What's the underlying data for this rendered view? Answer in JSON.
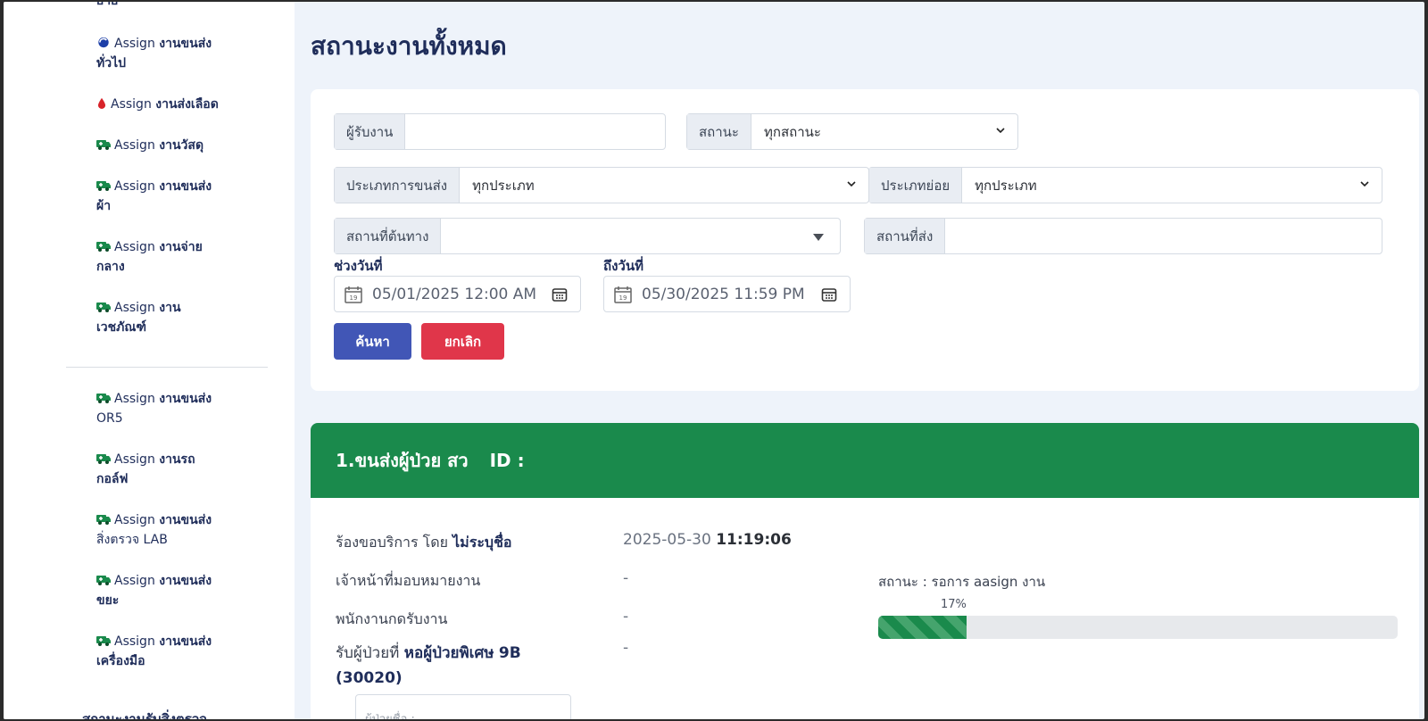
{
  "sidebar": {
    "top_cut_text": "ย้าย",
    "items": [
      {
        "en": "Assign",
        "th": "งานขนส่งทั่วไป",
        "th_a": "งานขนส่ง",
        "th_b": "ทั่วไป",
        "icon": "globe-icon"
      },
      {
        "en": "Assign",
        "th_a": "งานส่งเลือด",
        "th_b": "",
        "icon": "blood-drop-icon"
      },
      {
        "en": "Assign",
        "th_a": "งานวัสดุ",
        "th_b": "",
        "icon": "ambulance-icon"
      },
      {
        "en": "Assign",
        "th_a": "งานขนส่ง",
        "th_b": "ผ้า",
        "icon": "ambulance-icon"
      },
      {
        "en": "Assign",
        "th_a": "งานจ่าย",
        "th_b": "กลาง",
        "icon": "ambulance-icon"
      },
      {
        "en": "Assign",
        "th_a": "งาน",
        "th_b": "เวชภัณฑ์",
        "icon": "ambulance-icon"
      },
      {
        "en": "Assign",
        "th_a": "งานขนส่ง",
        "th_b": "OR5",
        "icon": "ambulance-icon"
      },
      {
        "en": "Assign",
        "th_a": "งานรถ",
        "th_b": "กอล์ฟ",
        "icon": "ambulance-icon"
      },
      {
        "en": "Assign",
        "th_a": "งานขนส่ง",
        "th_b": "สิ่งตรวจ LAB",
        "icon": "ambulance-icon"
      },
      {
        "en": "Assign",
        "th_a": "งานขนส่ง",
        "th_b": "ขยะ",
        "icon": "ambulance-icon"
      },
      {
        "en": "Assign",
        "th_a": "งานขนส่ง",
        "th_b": "เครื่องมือ",
        "icon": "ambulance-icon"
      }
    ],
    "bottom_cut_text": "สถานะงานรับสิ่งตรวจ"
  },
  "page_title": "สถานะงานทั้งหมด",
  "filters": {
    "assignee_label": "ผู้รับงาน",
    "assignee_value": "",
    "status_label": "สถานะ",
    "status_value": "ทุกสถานะ",
    "transport_type_label": "ประเภทการขนส่ง",
    "transport_type_value": "ทุกประเภท",
    "subtype_label": "ประเภทย่อย",
    "subtype_value": "ทุกประเภท",
    "origin_label": "สถานที่ต้นทาง",
    "origin_value": "",
    "destination_label": "สถานที่ส่ง",
    "destination_value": "",
    "from_date_label": "ช่วงวันที่",
    "from_date_value": "05/01/2025 12:00 AM",
    "to_date_label": "ถึงวันที่",
    "to_date_value": "05/30/2025 11:59 PM",
    "search_button": "ค้นหา",
    "cancel_button": "ยกเลิก"
  },
  "job": {
    "header_title": "1.ขนส่งผู้ป่วย สว",
    "header_id": "ID :",
    "requested_by_prefix": "ร้องขอบริการ โดย",
    "requested_by_name": "ไม่ระบุชื่อ",
    "requested_date": "2025-05-30",
    "requested_time": "11:19:06",
    "assigner_label": "เจ้าหน้าที่มอบหมายงาน",
    "assigner_value": "-",
    "receiver_label": "พนักงานกดรับงาน",
    "receiver_value": "-",
    "pickup_prefix": "รับผู้ป่วยที่",
    "pickup_ward": "หอผู้ป่วยพิเศษ",
    "pickup_ward_no": "9B",
    "pickup_code": "(30020)",
    "pickup_value": "-",
    "status_text": "สถานะ : รอการ aasign งาน",
    "progress_label": "17%",
    "progress": 0.17,
    "patient_name_placeholder": "ผู้ป่วยชื่อ :"
  }
}
